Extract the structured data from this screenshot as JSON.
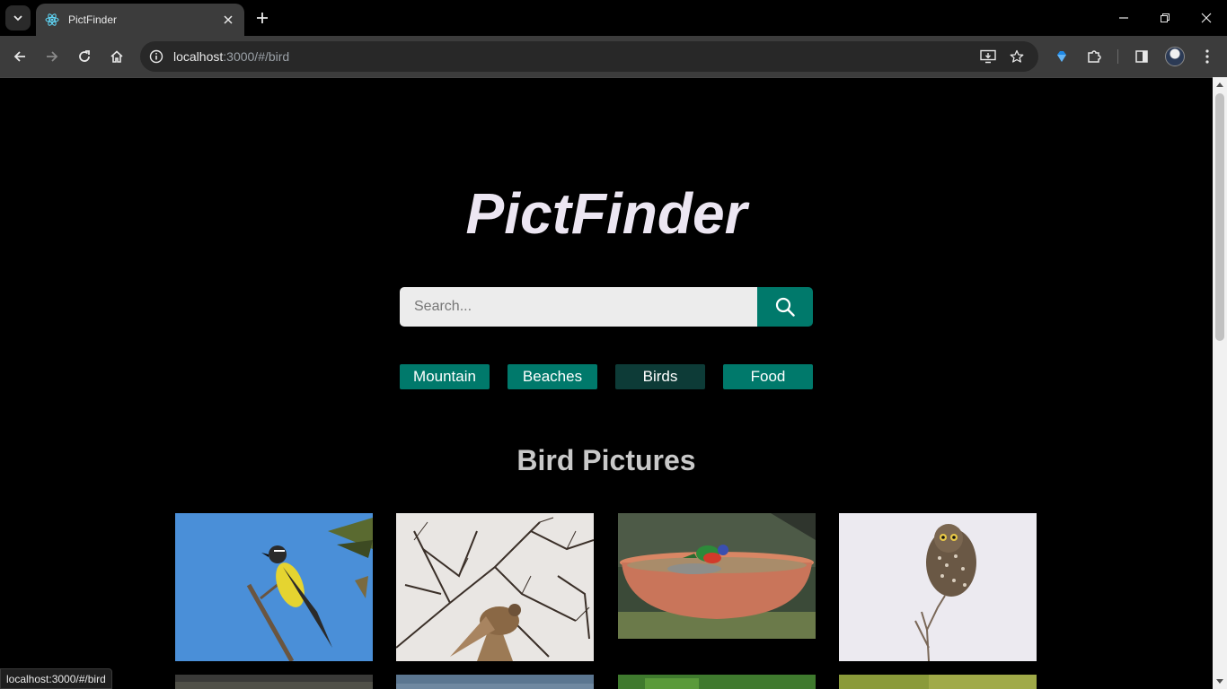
{
  "browser": {
    "tab_title": "PictFinder",
    "url_host": "localhost",
    "url_path": ":3000/#/bird",
    "status_url": "localhost:3000/#/bird"
  },
  "app": {
    "logo": "PictFinder",
    "search_placeholder": "Search...",
    "categories": [
      "Mountain",
      "Beaches",
      "Birds",
      "Food"
    ],
    "active_category": "Birds",
    "section_title": "Bird Pictures"
  },
  "colors": {
    "accent": "#00796b",
    "accent_active": "#0d3b37",
    "background": "#000000",
    "logo": "#ece6f2"
  },
  "photos": [
    {
      "subject": "yellow-bellied bird on branch, blue sky"
    },
    {
      "subject": "bird in flight among bare branches"
    },
    {
      "subject": "painted bunting at bird bath"
    },
    {
      "subject": "small owl perched on twig"
    },
    {
      "subject": "bird photo (partially visible)"
    },
    {
      "subject": "bird photo (partially visible)"
    },
    {
      "subject": "bird photo (partially visible)"
    },
    {
      "subject": "bird photo (partially visible)"
    }
  ]
}
